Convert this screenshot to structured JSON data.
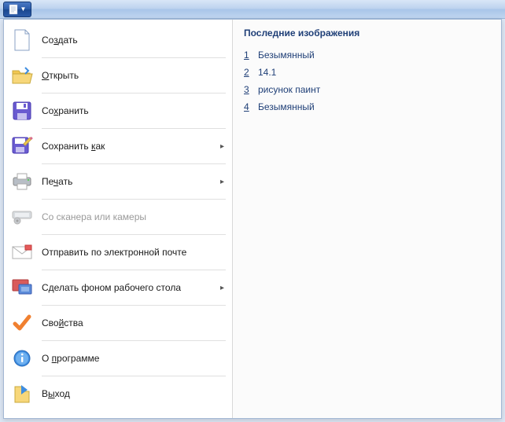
{
  "menu": {
    "new": "Создать",
    "open": "Открыть",
    "save": "Сохранить",
    "save_as": "Сохранить как",
    "print": "Печать",
    "scan": "Со сканера или камеры",
    "email": "Отправить по электронной почте",
    "wallpaper": "Сделать фоном рабочего стола",
    "properties": "Свойства",
    "about": "О программе",
    "exit": "Выход"
  },
  "accel": {
    "new": "з",
    "open": "О",
    "save": "х",
    "save_as": "к",
    "print": "ч",
    "properties": "й",
    "about": "п",
    "exit": "ы"
  },
  "recent": {
    "title": "Последние изображения",
    "items": [
      {
        "n": "1",
        "name": "Безымянный"
      },
      {
        "n": "2",
        "name": "14.1"
      },
      {
        "n": "3",
        "name": "рисунок паинт"
      },
      {
        "n": "4",
        "name": "Безымянный"
      }
    ]
  }
}
